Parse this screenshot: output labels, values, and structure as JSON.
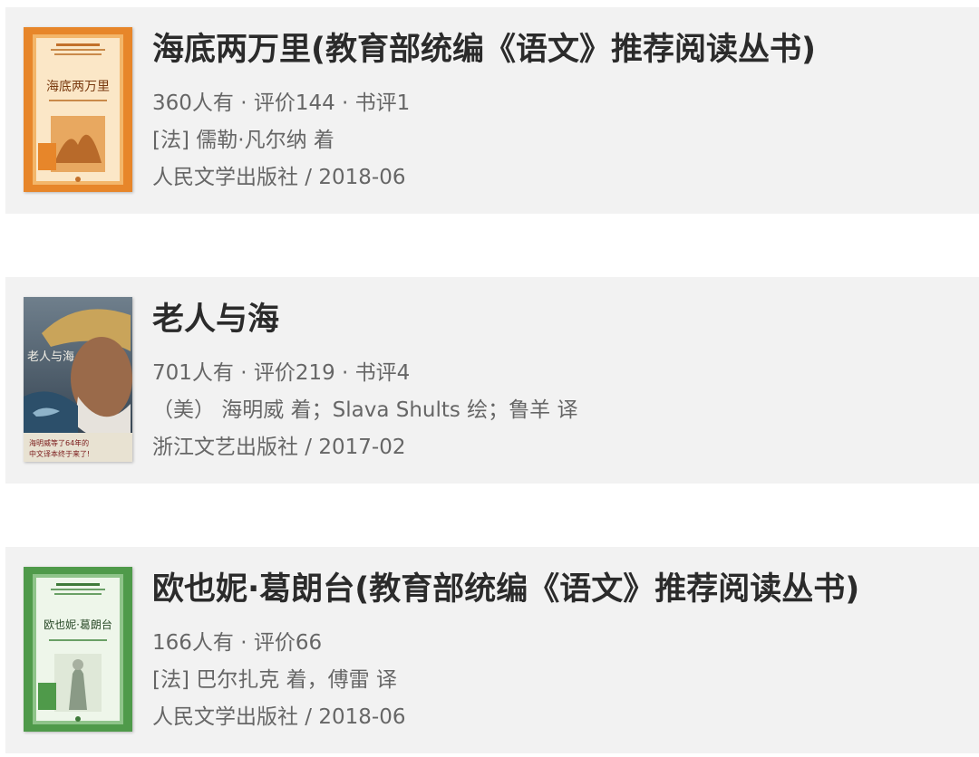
{
  "books": [
    {
      "title": "海底两万里(教育部统编《语文》推荐阅读丛书)",
      "stats": "360人有 · 评价144 · 书评1",
      "author": "[法] 儒勒·凡尔纳 着",
      "publisher": "人民文学出版社 / 2018-06",
      "cover": {
        "title": "海底两万里",
        "color": "#e7862a",
        "accent": "#f6c07a"
      }
    },
    {
      "title": "老人与海",
      "stats": "701人有 · 评价219 · 书评4",
      "author": "（美） 海明威 着；Slava Shults 绘；鲁羊 译",
      "publisher": "浙江文艺出版社 / 2017-02",
      "cover": {
        "title": "老人与海",
        "tagline": "海明威等了64年的中文译本终于来了!",
        "color": "#4a5a6a",
        "accent": "#c9a45a"
      }
    },
    {
      "title": "欧也妮·葛朗台(教育部统编《语文》推荐阅读丛书)",
      "stats": "166人有 · 评价66",
      "author": "[法] 巴尔扎克 着，傅雷 译",
      "publisher": "人民文学出版社 / 2018-06",
      "cover": {
        "title": "欧也妮·葛朗台",
        "color": "#4f9a4a",
        "accent": "#cfe5c4"
      }
    }
  ]
}
